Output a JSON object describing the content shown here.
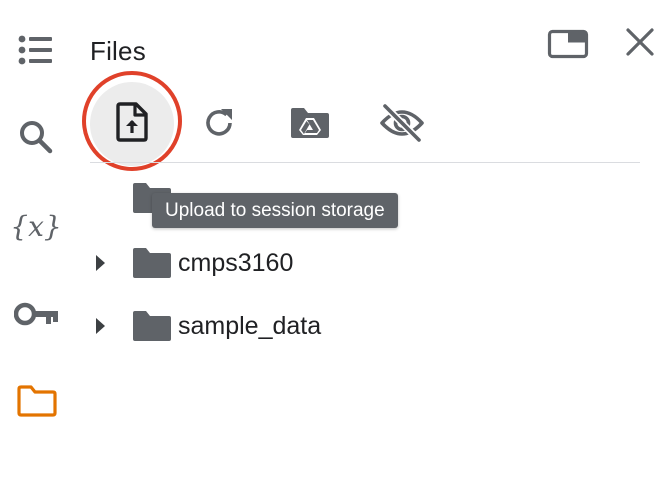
{
  "panel": {
    "title": "Files"
  },
  "sidebar": {
    "items": [
      {
        "icon": "table-of-contents-icon",
        "active": false
      },
      {
        "icon": "search-icon",
        "active": false
      },
      {
        "icon": "variables-icon",
        "glyph": "{x}",
        "active": false
      },
      {
        "icon": "key-icon",
        "active": false
      },
      {
        "icon": "folder-icon",
        "active": true
      }
    ],
    "active_color": "#e37400"
  },
  "toolbar": {
    "buttons": [
      {
        "icon": "upload-file-icon"
      },
      {
        "icon": "refresh-icon"
      },
      {
        "icon": "mount-drive-icon"
      },
      {
        "icon": "hide-hidden-files-icon"
      }
    ],
    "highlight_color": "#e0412a"
  },
  "tooltip": {
    "text": "Upload to session storage"
  },
  "file_tree": [
    {
      "name": "..",
      "type": "folder",
      "expandable": false
    },
    {
      "name": "cmps3160",
      "type": "folder",
      "expandable": true
    },
    {
      "name": "sample_data",
      "type": "folder",
      "expandable": true
    }
  ],
  "window_controls": [
    {
      "icon": "open-in-tab-icon"
    },
    {
      "icon": "close-icon"
    }
  ]
}
